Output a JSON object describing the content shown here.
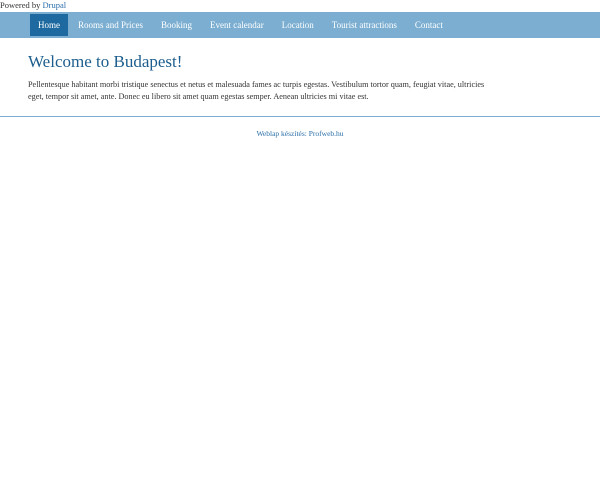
{
  "powered_by": {
    "prefix": "Powered by",
    "link": "Drupal"
  },
  "nav": {
    "items": [
      {
        "label": "Home",
        "active": true
      },
      {
        "label": "Rooms and Prices",
        "active": false
      },
      {
        "label": "Booking",
        "active": false
      },
      {
        "label": "Event calendar",
        "active": false
      },
      {
        "label": "Location",
        "active": false
      },
      {
        "label": "Tourist attractions",
        "active": false
      },
      {
        "label": "Contact",
        "active": false
      }
    ]
  },
  "main": {
    "title": "Welcome to Budapest!",
    "body": "Pellentesque habitant morbi tristique senectus et netus et malesuada fames ac turpis egestas. Vestibulum tortor quam, feugiat vitae, ultricies eget, tempor sit amet, ante. Donec eu libero sit amet quam egestas semper. Aenean ultricies mi vitae est."
  },
  "footer": {
    "credit": "Weblap készítés: Profweb.hu"
  },
  "colors": {
    "nav_background": "#7baed1",
    "nav_active": "#1e6aa0",
    "title": "#1d5e8e",
    "link": "#2a6ea8"
  }
}
